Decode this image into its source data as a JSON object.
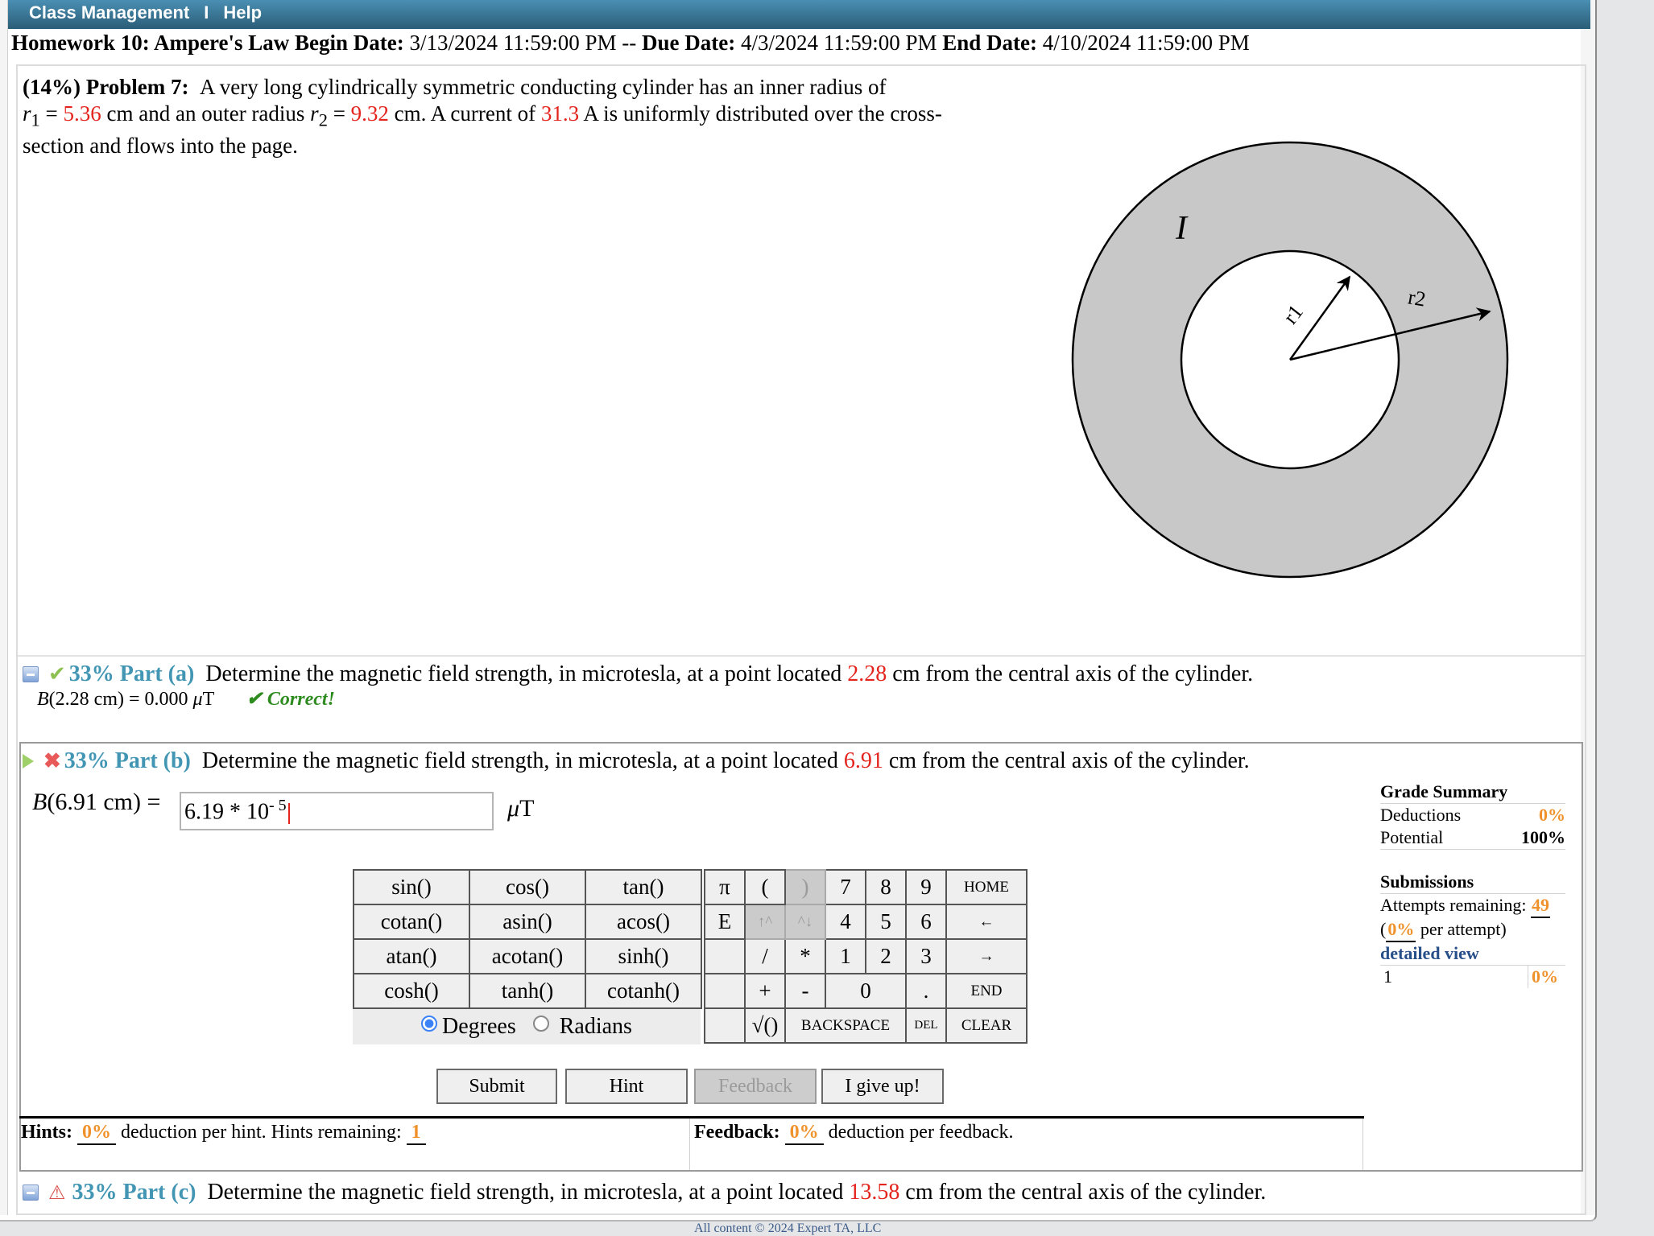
{
  "nav": {
    "items": [
      "Class Management",
      "Help"
    ],
    "separator": "I"
  },
  "homework": {
    "title": "Homework 10: Ampere's Law",
    "begin_label": "Begin Date:",
    "begin_date": "3/13/2024 11:59:00 PM",
    "dash": "--",
    "due_label": "Due Date:",
    "due_date": "4/3/2024 11:59:00 PM",
    "end_label": "End Date:",
    "end_date": "4/10/2024 11:59:00 PM"
  },
  "problem": {
    "weight": "(14%)",
    "label": "Problem 7:",
    "text_1": "A very long cylindrically symmetric conducting cylinder has an inner radius of",
    "r1_symbol": "r",
    "r1_sub": "1",
    "eq": "=",
    "r1_value": "5.36",
    "text_2": "cm and an outer radius",
    "r2_symbol": "r",
    "r2_sub": "2",
    "r2_value": "9.32",
    "text_3": "cm. A current of",
    "current_value": "31.3",
    "text_4": "A is uniformly distributed over the cross-section and flows into the page.",
    "diagram": {
      "current_label": "I",
      "inner_label": "r1",
      "outer_label": "r2"
    }
  },
  "parts": [
    {
      "percent_label": "33% Part (a)",
      "text_before": "Determine the magnetic field strength, in microtesla, at a point located",
      "distance": "2.28",
      "text_after": "cm from the central axis of the cylinder.",
      "status": "correct",
      "answer_lhs": "B",
      "answer_arg": "(2.28 cm) = 0.000",
      "answer_unit_mu": "μ",
      "answer_unit_t": "T",
      "result": "✔ Correct!"
    },
    {
      "percent_label": "33% Part (b)",
      "text_before": "Determine the magnetic field strength, in microtesla, at a point located",
      "distance": "6.91",
      "text_after": "cm from the central axis of the cylinder.",
      "status": "incorrect",
      "eq_lhs": "B",
      "eq_arg": "(6.91 cm)",
      "eq_sign": "=",
      "input_value": "6.19 * 10",
      "input_exponent": "- 5",
      "unit_mu": "μ",
      "unit_t": "T"
    },
    {
      "percent_label": "33% Part (c)",
      "text_before": "Determine the magnetic field strength, in microtesla, at a point located",
      "distance": "13.58",
      "text_after": "cm from the central axis of the cylinder.",
      "status": "warning"
    }
  ],
  "calculator": {
    "functions": [
      [
        "sin()",
        "cos()",
        "tan()"
      ],
      [
        "cotan()",
        "asin()",
        "acos()"
      ],
      [
        "atan()",
        "acotan()",
        "sinh()"
      ],
      [
        "cosh()",
        "tanh()",
        "cotanh()"
      ]
    ],
    "angle_modes": [
      {
        "label": "Degrees",
        "selected": true
      },
      {
        "label": "Radians",
        "selected": false
      }
    ],
    "keys": {
      "pi": "π",
      "open_paren": "(",
      "close_paren": ")",
      "seven": "7",
      "eight": "8",
      "nine": "9",
      "home": "HOME",
      "e": "E",
      "up_caret": "↑^",
      "caret_down": "^↓",
      "four": "4",
      "five": "5",
      "six": "6",
      "left": "←",
      "divide": "/",
      "multiply": "*",
      "one": "1",
      "two": "2",
      "three": "3",
      "right": "→",
      "plus": "+",
      "minus": "-",
      "zero": "0",
      "dot": ".",
      "end": "END",
      "sqrt": "√()",
      "backspace": "BACKSPACE",
      "del": "DEL",
      "clear": "CLEAR"
    }
  },
  "actions": {
    "submit": "Submit",
    "hint": "Hint",
    "feedback": "Feedback",
    "give_up": "I give up!"
  },
  "hints": {
    "label": "Hints:",
    "deduction": "0%",
    "text": "deduction per hint. Hints remaining:",
    "remaining": "1"
  },
  "feedback_info": {
    "label": "Feedback:",
    "deduction": "0%",
    "text": "deduction per feedback."
  },
  "grade_summary": {
    "title": "Grade Summary",
    "deductions_label": "Deductions",
    "deductions_value": "0%",
    "potential_label": "Potential",
    "potential_value": "100%"
  },
  "submissions": {
    "title": "Submissions",
    "attempts_label": "Attempts remaining:",
    "attempts_value": "49",
    "per_attempt_open": "(",
    "per_attempt_value": "0%",
    "per_attempt_text": "per attempt)",
    "detailed_view": "detailed view",
    "history": [
      {
        "n": "1",
        "value": "0%"
      }
    ]
  },
  "colors": {
    "accent_blue": "#4296b4",
    "value_red": "#e4231c",
    "orange": "#f0922b",
    "correct_green": "#2e8b1f"
  },
  "footer": "All content © 2024 Expert TA, LLC"
}
